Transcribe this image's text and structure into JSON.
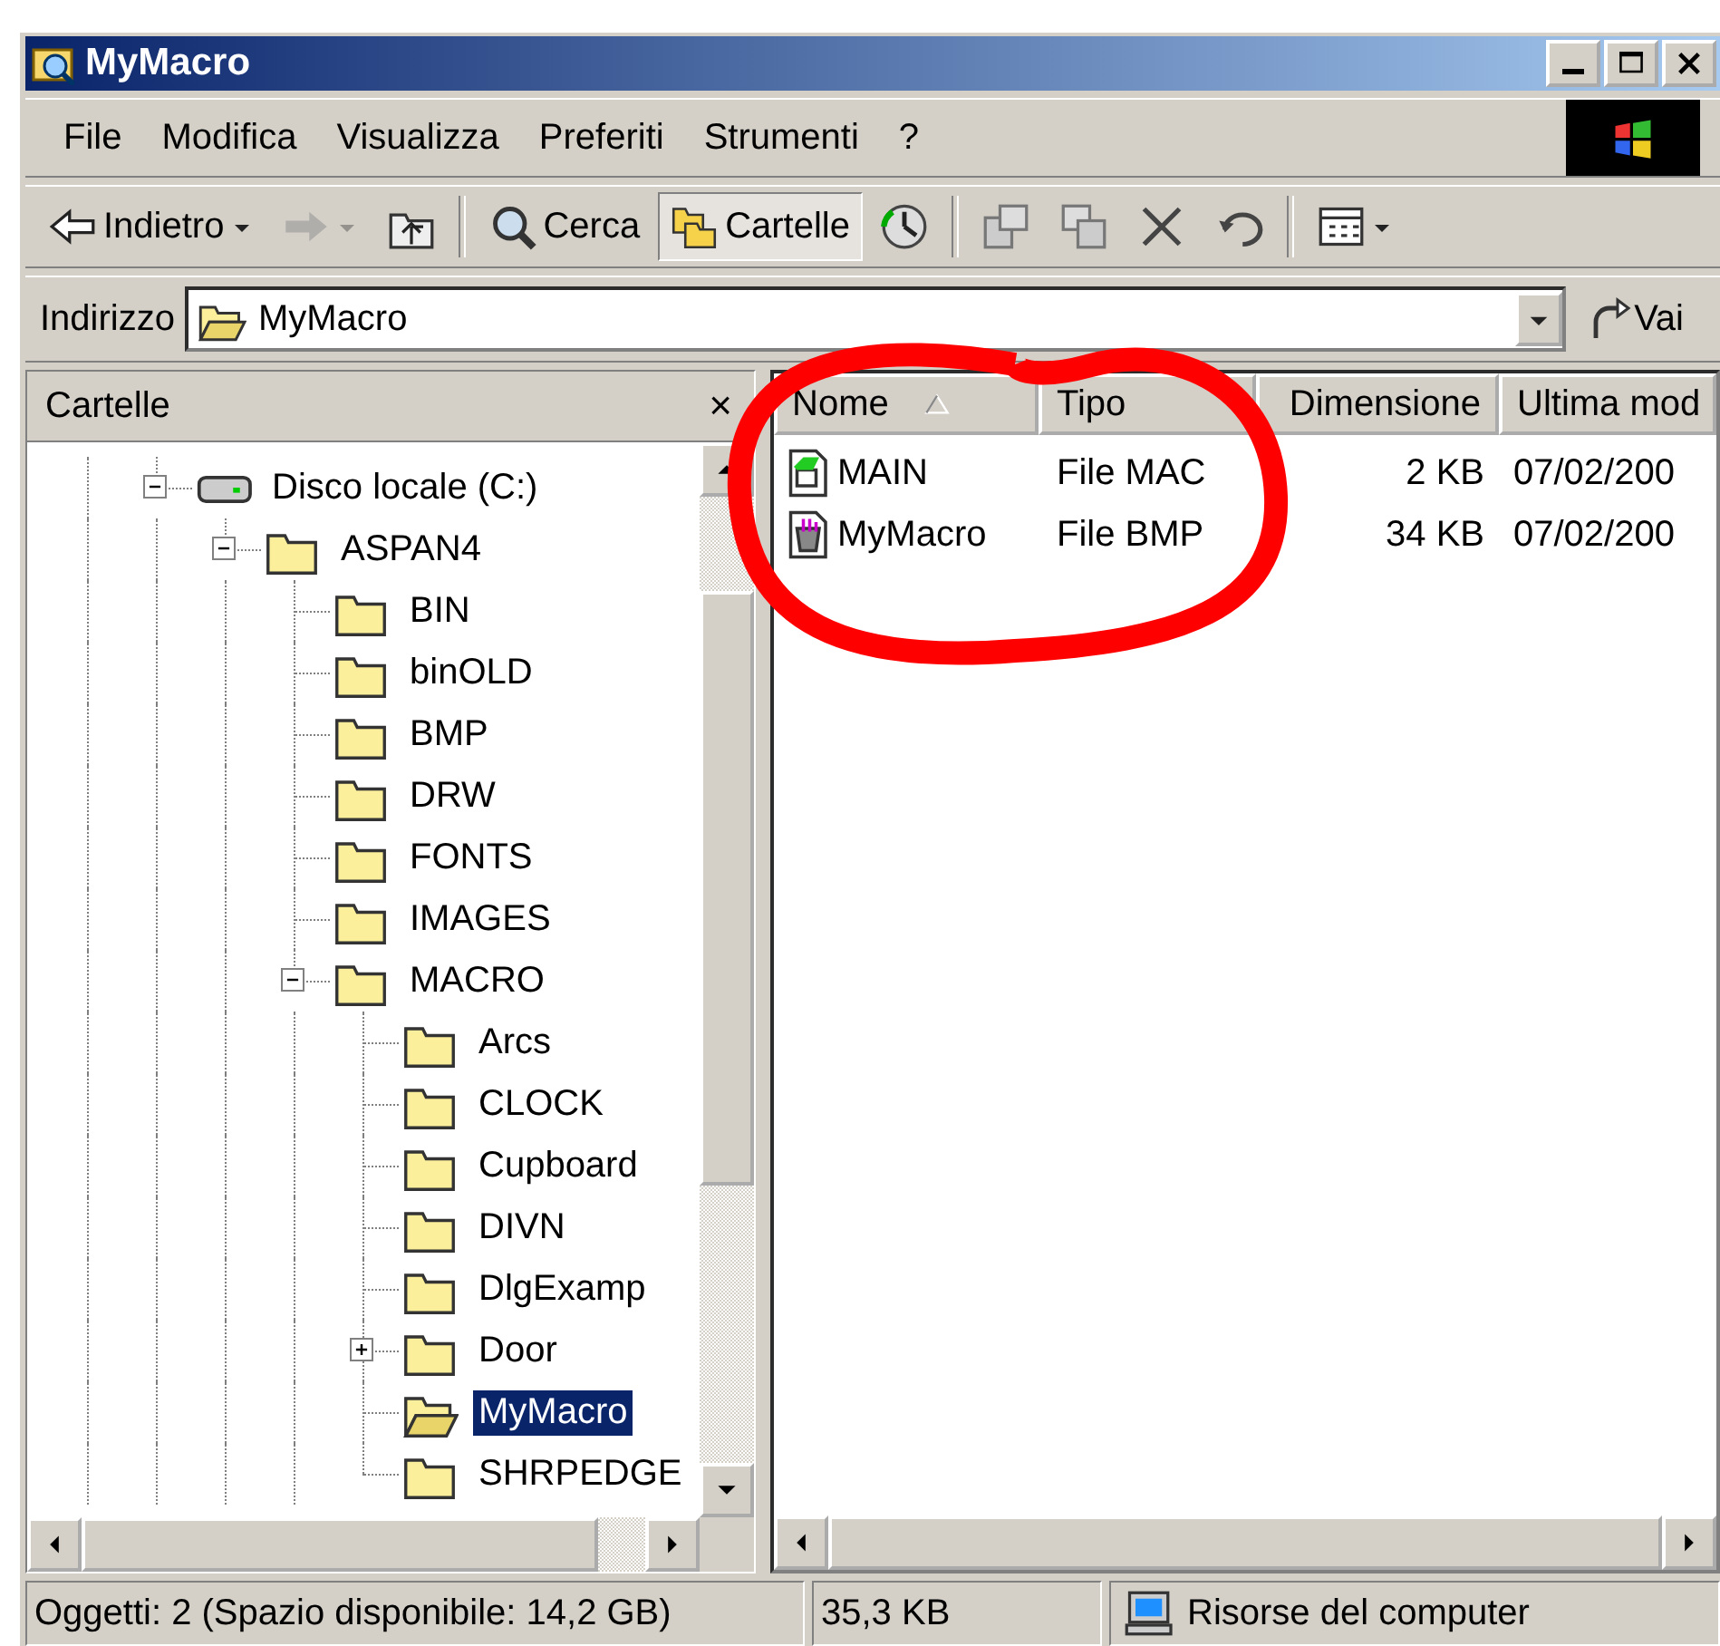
{
  "window": {
    "title": "MyMacro"
  },
  "menu": [
    "File",
    "Modifica",
    "Visualizza",
    "Preferiti",
    "Strumenti",
    "?"
  ],
  "toolbar": [
    {
      "kind": "back",
      "label": "Indietro",
      "dropdown": true,
      "disabled": false,
      "selected": false
    },
    {
      "kind": "forward",
      "dropdown": true,
      "disabled": true,
      "selected": false
    },
    {
      "kind": "up",
      "disabled": false,
      "selected": false
    },
    {
      "kind": "separator"
    },
    {
      "kind": "search",
      "label": "Cerca",
      "disabled": false,
      "selected": false
    },
    {
      "kind": "folders",
      "label": "Cartelle",
      "disabled": false,
      "selected": true
    },
    {
      "kind": "history",
      "disabled": false,
      "selected": false
    },
    {
      "kind": "separator"
    },
    {
      "kind": "move",
      "disabled": false,
      "selected": false
    },
    {
      "kind": "copy",
      "disabled": false,
      "selected": false
    },
    {
      "kind": "delete",
      "disabled": false,
      "selected": false
    },
    {
      "kind": "undo",
      "disabled": false,
      "selected": false
    },
    {
      "kind": "separator"
    },
    {
      "kind": "views",
      "dropdown": true,
      "disabled": false,
      "selected": false
    }
  ],
  "address": {
    "label": "Indirizzo",
    "value": "MyMacro",
    "go": "Vai"
  },
  "folders_pane": {
    "title": "Cartelle",
    "close": "×",
    "tree": [
      {
        "kind": "drive",
        "label": "Disco locale (C:)",
        "expanded": true,
        "selected": false,
        "children": [
          {
            "kind": "folder",
            "label": "ASPAN4",
            "expanded": true,
            "selected": false,
            "children": [
              {
                "kind": "folder",
                "label": "BIN",
                "selected": false
              },
              {
                "kind": "folder",
                "label": "binOLD",
                "selected": false
              },
              {
                "kind": "folder",
                "label": "BMP",
                "selected": false
              },
              {
                "kind": "folder",
                "label": "DRW",
                "selected": false
              },
              {
                "kind": "folder",
                "label": "FONTS",
                "selected": false
              },
              {
                "kind": "folder",
                "label": "IMAGES",
                "selected": false
              },
              {
                "kind": "folder",
                "label": "MACRO",
                "expanded": true,
                "selected": false,
                "children": [
                  {
                    "kind": "folder",
                    "label": "Arcs",
                    "selected": false
                  },
                  {
                    "kind": "folder",
                    "label": "CLOCK",
                    "selected": false
                  },
                  {
                    "kind": "folder",
                    "label": "Cupboard",
                    "selected": false
                  },
                  {
                    "kind": "folder",
                    "label": "DIVN",
                    "selected": false
                  },
                  {
                    "kind": "folder",
                    "label": "DlgExamp",
                    "selected": false
                  },
                  {
                    "kind": "folder",
                    "label": "Door",
                    "expanded": false,
                    "selected": false
                  },
                  {
                    "kind": "folder",
                    "label": "MyMacro",
                    "selected": true
                  },
                  {
                    "kind": "folder",
                    "label": "SHRPEDGE",
                    "selected": false
                  }
                ]
              }
            ]
          }
        ]
      }
    ]
  },
  "file_list": {
    "columns": [
      {
        "label": "Nome",
        "sorted": true
      },
      {
        "label": "Tipo"
      },
      {
        "label": "Dimensione"
      },
      {
        "label": "Ultima mod"
      }
    ],
    "rows": [
      {
        "kind": "mac",
        "cells": [
          "MAIN",
          "File MAC",
          "2 KB",
          "07/02/200"
        ],
        "selected": false
      },
      {
        "kind": "bmp",
        "cells": [
          "MyMacro",
          "File BMP",
          "34 KB",
          "07/02/200"
        ],
        "selected": false
      }
    ]
  },
  "status_bar": {
    "objects": "Oggetti: 2 (Spazio disponibile: 14,2 GB)",
    "size": "35,3 KB",
    "zone": "Risorse del computer"
  }
}
